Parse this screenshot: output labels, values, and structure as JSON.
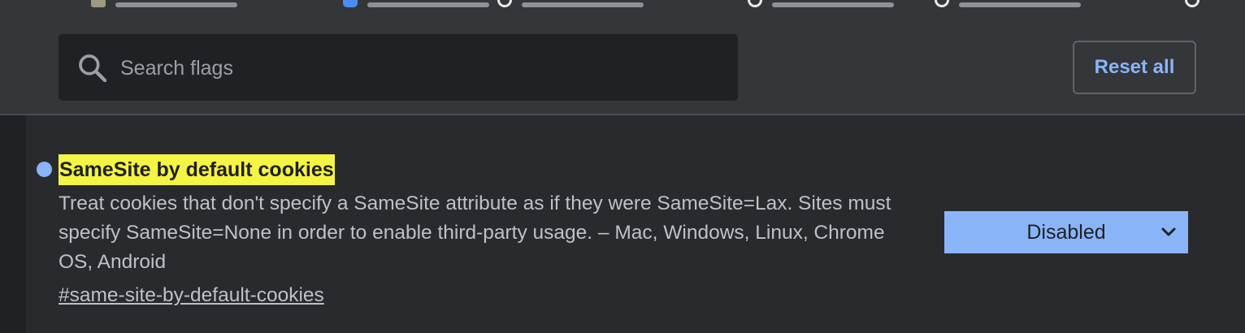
{
  "search": {
    "placeholder": "Search flags"
  },
  "header": {
    "reset_label": "Reset all"
  },
  "flag": {
    "title": "SameSite by default cookies",
    "description": "Treat cookies that don't specify a SameSite attribute as if they were SameSite=Lax. Sites must specify SameSite=None in order to enable third-party usage. – Mac, Windows, Linux, Chrome OS, Android",
    "link": "#same-site-by-default-cookies",
    "selected_option": "Disabled"
  },
  "colors": {
    "accent": "#8ab4f8",
    "highlight": "#f4f445",
    "background": "#202124"
  }
}
